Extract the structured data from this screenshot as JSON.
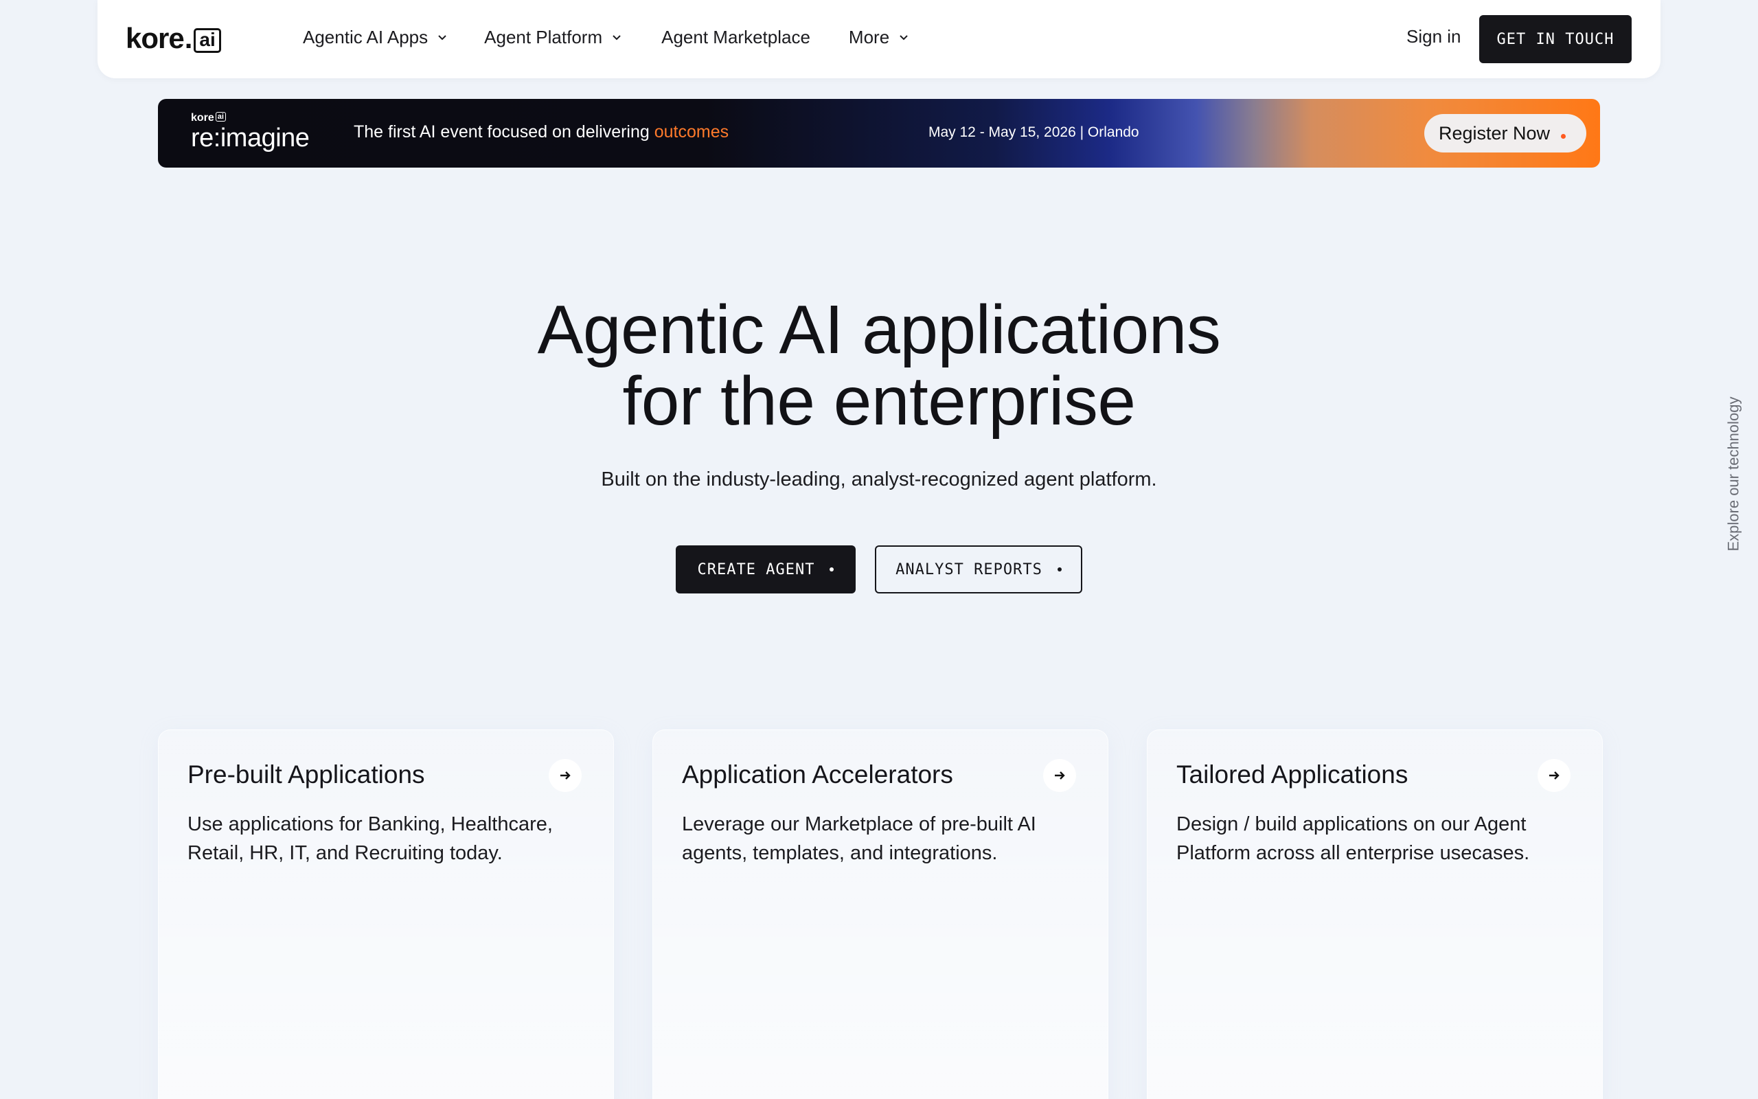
{
  "nav": {
    "logo": {
      "word": "kore",
      "dot": ".",
      "ai": "ai"
    },
    "items": [
      {
        "label": "Agentic AI Apps",
        "dropdown": true
      },
      {
        "label": "Agent Platform",
        "dropdown": true
      },
      {
        "label": "Agent Marketplace",
        "dropdown": false
      },
      {
        "label": "More",
        "dropdown": true
      }
    ],
    "sign_in": "Sign in",
    "cta": "GET IN TOUCH"
  },
  "banner": {
    "brand_small": "kore",
    "brand_small_ai": "ai",
    "brand_big": "re:imagine",
    "text_prefix": "The first AI event focused on delivering ",
    "text_highlight": "outcomes",
    "date": "May 12 - May 15, 2026 | Orlando",
    "register": "Register Now"
  },
  "hero": {
    "title_line1": "Agentic AI applications",
    "title_line2": "for the enterprise",
    "subtitle": "Built on the industy-leading, analyst-recognized agent platform.",
    "primary_button": "CREATE AGENT",
    "secondary_button": "ANALYST REPORTS"
  },
  "side_tab": "Explore our technology",
  "cards": [
    {
      "title": "Pre-built Applications",
      "description": "Use applications for Banking, Healthcare, Retail, HR, IT, and Recruiting today."
    },
    {
      "title": "Application Accelerators",
      "description": "Leverage our Marketplace of pre-built AI agents, templates, and integrations."
    },
    {
      "title": "Tailored Applications",
      "description": "Design / build applications on our Agent Platform across all enterprise usecases."
    }
  ],
  "colors": {
    "background": "#eff3f9",
    "dark": "#15151a",
    "accent_orange": "#ff7a2b",
    "register_dot": "#ff5a1f"
  },
  "icons": {
    "dropdown": "chevron-down-icon",
    "card_arrow": "arrow-right-icon",
    "button_dot": "dot-icon"
  }
}
